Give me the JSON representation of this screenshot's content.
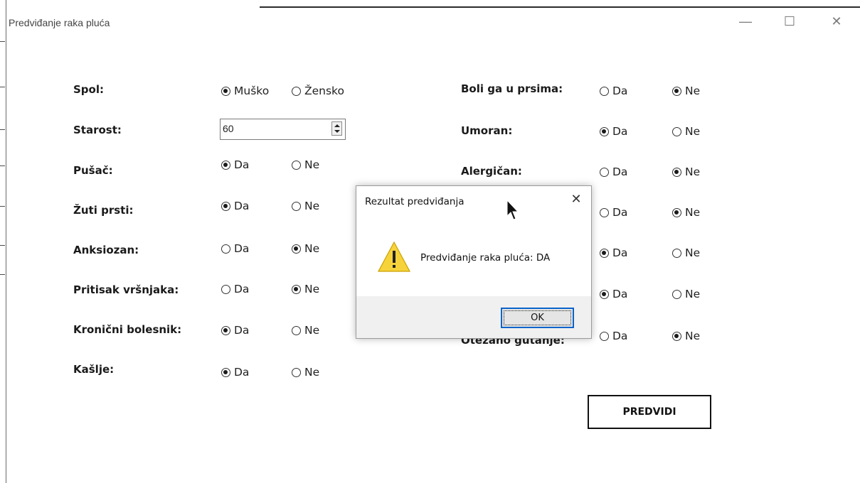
{
  "window": {
    "title": "Predviđanje raka pluća",
    "minimize_glyph": "—",
    "maximize_glyph": "☐",
    "close_glyph": "✕"
  },
  "form": {
    "left": [
      {
        "label": "Spol:",
        "options": [
          "Muško",
          "Žensko"
        ],
        "selected": 0
      },
      {
        "label": "Starost:",
        "value": "60"
      },
      {
        "label": "Pušač:",
        "options": [
          "Da",
          "Ne"
        ],
        "selected": 0
      },
      {
        "label": "Žuti prsti:",
        "options": [
          "Da",
          "Ne"
        ],
        "selected": 0
      },
      {
        "label": "Anksiozan:",
        "options": [
          "Da",
          "Ne"
        ],
        "selected": 1
      },
      {
        "label": "Pritisak vršnjaka:",
        "options": [
          "Da",
          "Ne"
        ],
        "selected": 1
      },
      {
        "label": "Kronični bolesnik:",
        "options": [
          "Da",
          "Ne"
        ],
        "selected": 0
      },
      {
        "label": "Kašlje:",
        "options": [
          "Da",
          "Ne"
        ],
        "selected": 0
      }
    ],
    "right": [
      {
        "label": "Boli ga u prsima:",
        "options": [
          "Da",
          "Ne"
        ],
        "selected": 1
      },
      {
        "label": "Umoran:",
        "options": [
          "Da",
          "Ne"
        ],
        "selected": 0
      },
      {
        "label": "Alergičan:",
        "options": [
          "Da",
          "Ne"
        ],
        "selected": 1
      },
      {
        "label": "",
        "options": [
          "Da",
          "Ne"
        ],
        "selected": 1
      },
      {
        "label": "",
        "options": [
          "Da",
          "Ne"
        ],
        "selected": 0
      },
      {
        "label": "",
        "options": [
          "Da",
          "Ne"
        ],
        "selected": 0
      },
      {
        "label": "Otežano gutanje:",
        "options": [
          "Da",
          "Ne"
        ],
        "selected": 1
      }
    ],
    "predict_button": "PREDVIDI"
  },
  "dialog": {
    "title": "Rezultat predviđanja",
    "close_glyph": "✕",
    "message": "Predviđanje raka pluća: DA",
    "icon": "warning-icon",
    "ok_label": "OK"
  },
  "colors": {
    "warning_fill": "#f7d33b",
    "ok_border": "#0a63c9"
  }
}
